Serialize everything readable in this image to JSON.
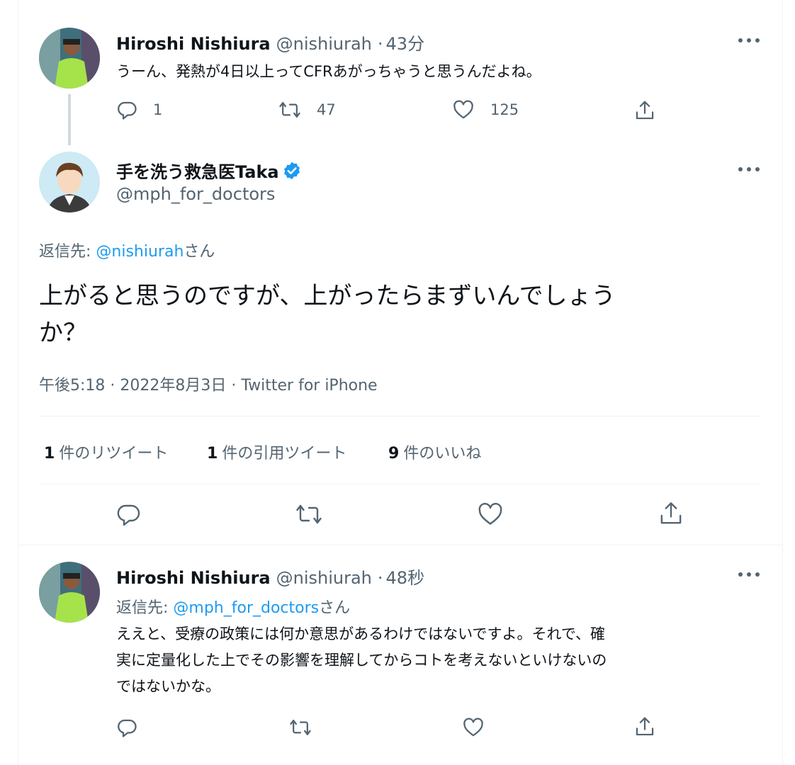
{
  "tweet1": {
    "name": "Hiroshi Nishiura",
    "handle": "@nishiurah",
    "sep": "·",
    "time": "43分",
    "text": "うーん、発熱が4日以上ってCFRあがっちゃうと思うんだよね。",
    "replies": "1",
    "retweets": "47",
    "likes": "125"
  },
  "tweet2": {
    "name": "手を洗う救急医Taka",
    "handle": "@mph_for_doctors",
    "verified": true,
    "reply_prefix": "返信先: ",
    "reply_to": "@nishiurah",
    "reply_suffix": "さん",
    "text_line1": "上がると思うのですが、上がったらまずいんでしょう",
    "text_line2": "か？",
    "timestamp": "午後5:18 · 2022年8月3日 · Twitter for iPhone",
    "stats": [
      {
        "count": "1",
        "label": "件のリツイート"
      },
      {
        "count": "1",
        "label": "件の引用ツイート"
      },
      {
        "count": "9",
        "label": "件のいいね"
      }
    ]
  },
  "tweet3": {
    "name": "Hiroshi Nishiura",
    "handle": "@nishiurah",
    "sep": "·",
    "time": "48秒",
    "reply_prefix": "返信先: ",
    "reply_to": "@mph_for_doctors",
    "reply_suffix": "さん",
    "text_line1": "ええと、受療の政策には何か意思があるわけではないですよ。それで、確",
    "text_line2": "実に定量化した上でその影響を理解してからコトを考えないといけないの",
    "text_line3": "ではないかな。"
  },
  "colors": {
    "link": "#1d9bf0",
    "secondary": "#536471",
    "divider": "#eff3f4",
    "verified": "#1d9bf0"
  },
  "icons": [
    "reply-icon",
    "retweet-icon",
    "like-icon",
    "share-icon",
    "more-icon",
    "verified-icon"
  ]
}
